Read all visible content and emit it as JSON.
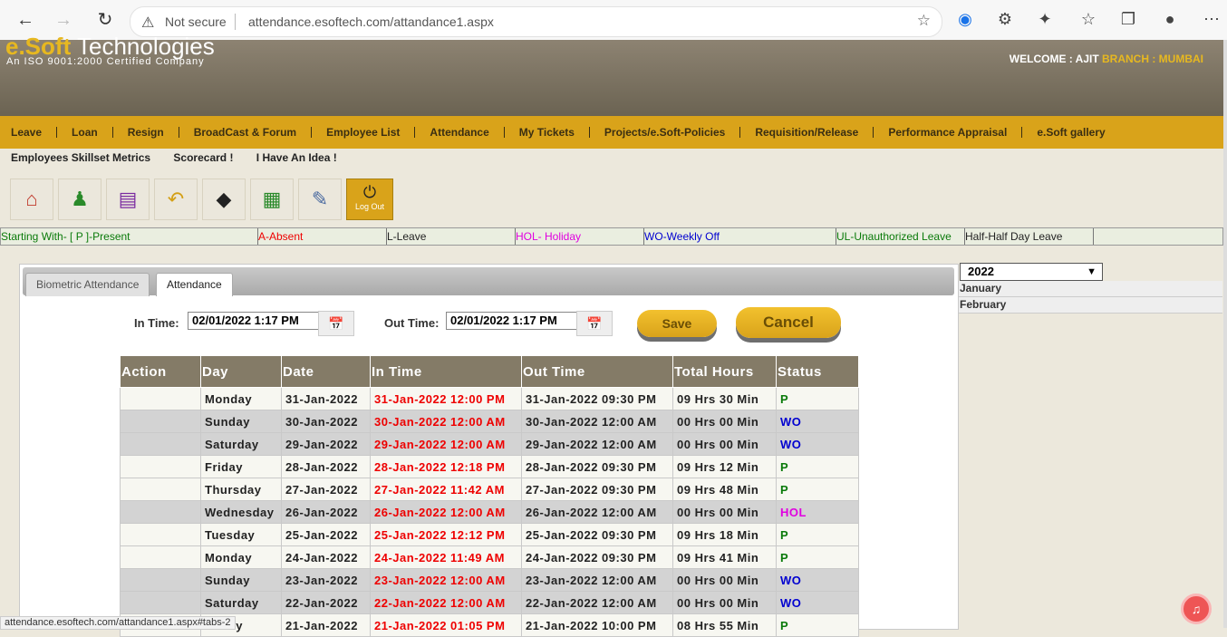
{
  "browser": {
    "security_label": "Not secure",
    "url": "attendance.esoftech.com/attandance1.aspx",
    "status_url": "attendance.esoftech.com/attandance1.aspx#tabs-2"
  },
  "header": {
    "logo_e": "e.Soft",
    "logo_rest": " Technologies",
    "tagline": "An ISO 9001:2000 Certified Company",
    "welcome": "WELCOME : AJIT",
    "branch": "BRANCH : MUMBAI"
  },
  "menu": {
    "items": [
      "Leave",
      "Loan",
      "Resign",
      "BroadCast & Forum",
      "Employee List",
      "Attendance",
      "My Tickets",
      "Projects/e.Soft-Policies",
      "Requisition/Release",
      "Performance Appraisal",
      "e.Soft gallery"
    ],
    "sub_items": [
      "Employees Skillset Metrics",
      "Scorecard !",
      "I Have An Idea !"
    ]
  },
  "toolbar": {
    "logout_label": "Log Out"
  },
  "legend": {
    "present": "Starting With- [ P ]-Present",
    "absent": "A-Absent",
    "leave": "L-Leave",
    "holiday": "HOL- Holiday",
    "weekly_off": "WO-Weekly Off",
    "unauth": "UL-Unauthorized Leave",
    "half": "Half-Half Day Leave"
  },
  "tabs": {
    "biometric": "Biometric Attendance",
    "attendance": "Attendance"
  },
  "form": {
    "in_time_label": "In Time:",
    "in_time_value": "02/01/2022 1:17 PM",
    "out_time_label": "Out Time:",
    "out_time_value": "02/01/2022 1:17 PM",
    "save_label": "Save",
    "cancel_label": "Cancel"
  },
  "table": {
    "headers": [
      "Action",
      "Day",
      "Date",
      "In Time",
      "Out Time",
      "Total Hours",
      "Status"
    ],
    "rows": [
      {
        "day": "Monday",
        "date": "31-Jan-2022",
        "in": "31-Jan-2022 12:00 PM",
        "out": "31-Jan-2022 09:30 PM",
        "hours": "09 Hrs 30 Min",
        "status": "P"
      },
      {
        "day": "Sunday",
        "date": "30-Jan-2022",
        "in": "30-Jan-2022 12:00 AM",
        "out": "30-Jan-2022 12:00 AM",
        "hours": "00 Hrs 00 Min",
        "status": "WO"
      },
      {
        "day": "Saturday",
        "date": "29-Jan-2022",
        "in": "29-Jan-2022 12:00 AM",
        "out": "29-Jan-2022 12:00 AM",
        "hours": "00 Hrs 00 Min",
        "status": "WO"
      },
      {
        "day": "Friday",
        "date": "28-Jan-2022",
        "in": "28-Jan-2022 12:18 PM",
        "out": "28-Jan-2022 09:30 PM",
        "hours": "09 Hrs 12 Min",
        "status": "P"
      },
      {
        "day": "Thursday",
        "date": "27-Jan-2022",
        "in": "27-Jan-2022 11:42 AM",
        "out": "27-Jan-2022 09:30 PM",
        "hours": "09 Hrs 48 Min",
        "status": "P"
      },
      {
        "day": "Wednesday",
        "date": "26-Jan-2022",
        "in": "26-Jan-2022 12:00 AM",
        "out": "26-Jan-2022 12:00 AM",
        "hours": "00 Hrs 00 Min",
        "status": "HOL"
      },
      {
        "day": "Tuesday",
        "date": "25-Jan-2022",
        "in": "25-Jan-2022 12:12 PM",
        "out": "25-Jan-2022 09:30 PM",
        "hours": "09 Hrs 18 Min",
        "status": "P"
      },
      {
        "day": "Monday",
        "date": "24-Jan-2022",
        "in": "24-Jan-2022 11:49 AM",
        "out": "24-Jan-2022 09:30 PM",
        "hours": "09 Hrs 41 Min",
        "status": "P"
      },
      {
        "day": "Sunday",
        "date": "23-Jan-2022",
        "in": "23-Jan-2022 12:00 AM",
        "out": "23-Jan-2022 12:00 AM",
        "hours": "00 Hrs 00 Min",
        "status": "WO"
      },
      {
        "day": "Saturday",
        "date": "22-Jan-2022",
        "in": "22-Jan-2022 12:00 AM",
        "out": "22-Jan-2022 12:00 AM",
        "hours": "00 Hrs 00 Min",
        "status": "WO"
      },
      {
        "day": "Friday",
        "date": "21-Jan-2022",
        "in": "21-Jan-2022 01:05 PM",
        "out": "21-Jan-2022 10:00 PM",
        "hours": "08 Hrs 55 Min",
        "status": "P"
      }
    ]
  },
  "sidebar": {
    "year": "2022",
    "months": [
      "January",
      "February"
    ]
  },
  "colors": {
    "P": "#0a7a0a",
    "WO": "#0000d0",
    "HOL": "#e000e0"
  }
}
